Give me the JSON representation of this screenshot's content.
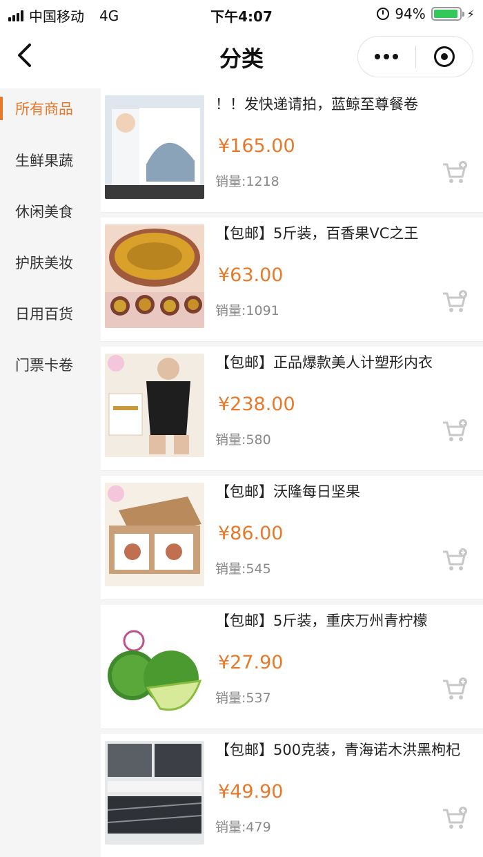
{
  "status_bar": {
    "carrier": "中国移动",
    "network": "4G",
    "time": "下午4:07",
    "battery_percent": "94%",
    "battery_level": 0.94
  },
  "nav": {
    "title": "分类"
  },
  "sidebar": {
    "items": [
      {
        "label": "所有商品",
        "active": true
      },
      {
        "label": "生鲜果蔬",
        "active": false
      },
      {
        "label": "休闲美食",
        "active": false
      },
      {
        "label": "护肤美妆",
        "active": false
      },
      {
        "label": "日用百货",
        "active": false
      },
      {
        "label": "门票卡卷",
        "active": false
      }
    ]
  },
  "products": [
    {
      "title": "！！发快递请拍，蓝鲸至尊餐卷",
      "price": "¥165.00",
      "sales": "销量:1218"
    },
    {
      "title": "【包邮】5斤装，百香果VC之王",
      "price": "¥63.00",
      "sales": "销量:1091"
    },
    {
      "title": "【包邮】正品爆款美人计塑形内衣",
      "price": "¥238.00",
      "sales": "销量:580"
    },
    {
      "title": "【包邮】沃隆每日坚果",
      "price": "¥86.00",
      "sales": "销量:545"
    },
    {
      "title": "【包邮】5斤装，重庆万州青柠檬",
      "price": "¥27.90",
      "sales": "销量:537"
    },
    {
      "title": "【包邮】500克装，青海诺木洪黑枸杞",
      "price": "¥49.90",
      "sales": "销量:479"
    }
  ],
  "colors": {
    "accent": "#e7792b",
    "sidebar_bg": "#f5f5f5",
    "muted_text": "#888888"
  }
}
